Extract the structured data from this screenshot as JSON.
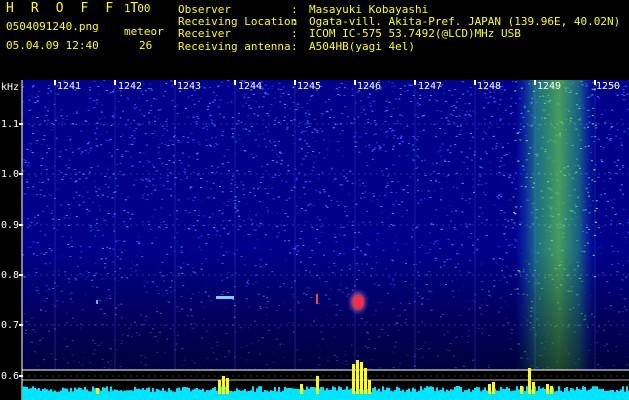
{
  "header": {
    "app_title": "H R O F F T",
    "version": "1.00",
    "filename": "0504091240.png",
    "datetime": "05.04.09 12:40",
    "meteor_label": "meteor",
    "meteor_count": "26",
    "info": [
      {
        "key": "Observer",
        "value": "Masayuki Kobayashi"
      },
      {
        "key": "Receiving Location",
        "value": "Ogata-vill. Akita-Pref. JAPAN (139.96E, 40.02N)"
      },
      {
        "key": "Receiver",
        "value": "ICOM IC-575 53.7492(@LCD)MHz USB"
      },
      {
        "key": "Receiving antenna",
        "value": "A504HB(yagi 4el)"
      }
    ]
  },
  "spectrogram": {
    "y_unit": "kHz",
    "y_ticks": [
      "1.1",
      "1.0",
      "0.9",
      "0.8",
      "0.7",
      "0.6"
    ],
    "x_ticks": [
      "1241",
      "1242",
      "1243",
      "1244",
      "1245",
      "1246",
      "1247",
      "1248",
      "1249",
      "1250"
    ],
    "colors": {
      "background": "#00008a",
      "noise": "#1e3cff",
      "strong": "#33cc55",
      "meteor": "#ff2222",
      "trace_baseline": "#00e5ff",
      "trace_peak": "#ffff00"
    }
  }
}
